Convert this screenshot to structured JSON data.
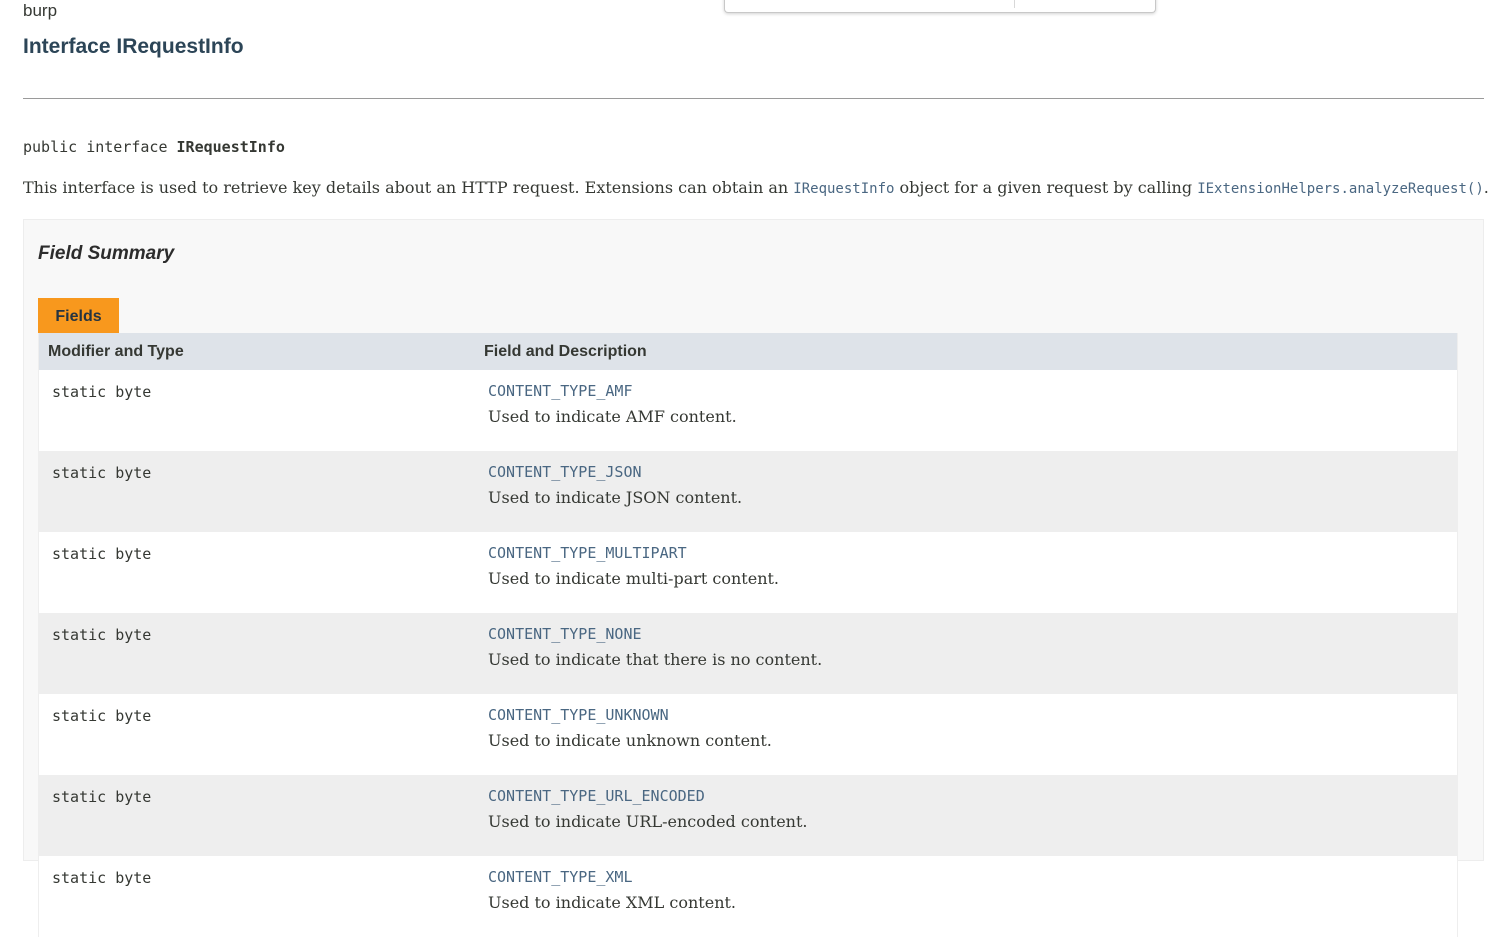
{
  "package": "burp",
  "title": "Interface IRequestInfo",
  "signature": {
    "modifiers": "public interface ",
    "name": "IRequestInfo"
  },
  "description": {
    "part1": "This interface is used to retrieve key details about an HTTP request. Extensions can obtain an ",
    "code1": "IRequestInfo",
    "part2": " object for a given request by calling ",
    "code2": "IExtensionHelpers.analyzeRequest()",
    "part3": "."
  },
  "field_summary": {
    "heading": "Field Summary",
    "tab_label": "Fields",
    "columns": [
      "Modifier and Type",
      "Field and Description"
    ],
    "rows": [
      {
        "type": "static byte",
        "name": "CONTENT_TYPE_AMF",
        "desc": "Used to indicate AMF content."
      },
      {
        "type": "static byte",
        "name": "CONTENT_TYPE_JSON",
        "desc": "Used to indicate JSON content."
      },
      {
        "type": "static byte",
        "name": "CONTENT_TYPE_MULTIPART",
        "desc": "Used to indicate multi-part content."
      },
      {
        "type": "static byte",
        "name": "CONTENT_TYPE_NONE",
        "desc": "Used to indicate that there is no content."
      },
      {
        "type": "static byte",
        "name": "CONTENT_TYPE_UNKNOWN",
        "desc": "Used to indicate unknown content."
      },
      {
        "type": "static byte",
        "name": "CONTENT_TYPE_URL_ENCODED",
        "desc": "Used to indicate URL-encoded content."
      },
      {
        "type": "static byte",
        "name": "CONTENT_TYPE_XML",
        "desc": "Used to indicate XML content."
      }
    ]
  },
  "colors": {
    "title": "#2c4557",
    "link": "#4a6782",
    "tab": "#f8981d",
    "table_header": "#dee3e9",
    "row_alt": "#eeeeee"
  }
}
